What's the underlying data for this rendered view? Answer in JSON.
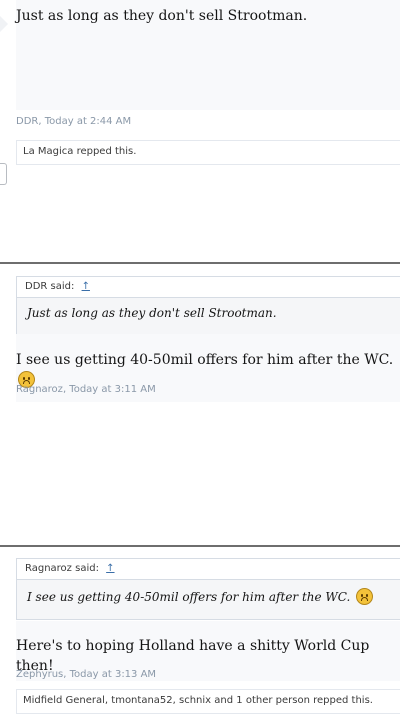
{
  "posts": [
    {
      "body": "Just as long as they don't sell Strootman.",
      "author": "DDR",
      "time": "Today at 2:44 AM",
      "reps": "La Magica repped this."
    },
    {
      "quote_author_label": "DDR said:",
      "quote_arrow": "↑",
      "quote_text": "Just as long as they don't sell Strootman.",
      "body": "I see us getting 40-50mil offers for him after the WC.",
      "author": "Ragnaroz",
      "time": "Today at 3:11 AM"
    },
    {
      "quote_author_label": "Ragnaroz said:",
      "quote_arrow": "↑",
      "quote_text": "I see us getting 40-50mil offers for him after the WC.",
      "body": "Here's to hoping Holland have a shitty World Cup then!",
      "author": "Zephyrus",
      "time": "Today at 3:13 AM",
      "reps_names": [
        "Midfield General",
        "tmontana52",
        "schnix"
      ],
      "reps_and": "and",
      "reps_other": "1 other person",
      "reps_suffix": "repped this."
    }
  ],
  "meta_separator": ", ",
  "icons": {
    "sad_emoji": "frown-emoji-icon",
    "quote_jump": "arrow-up-icon"
  }
}
